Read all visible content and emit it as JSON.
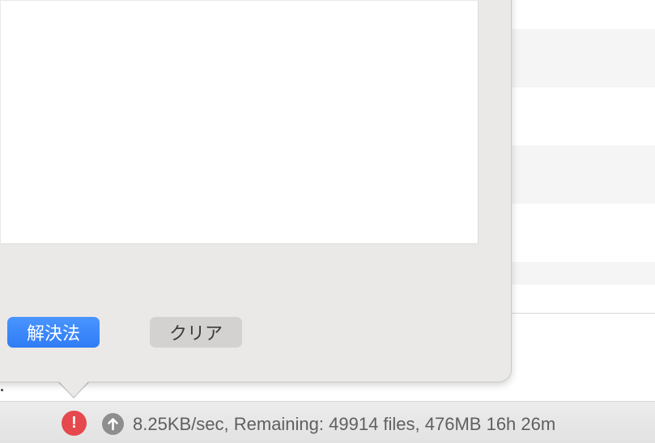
{
  "popover": {
    "buttons": {
      "solution_label": "解決法",
      "clear_label": "クリア"
    }
  },
  "status_bar": {
    "error_icon": "exclamation-icon",
    "error_glyph": "!",
    "upload_icon": "upload-arrow-icon",
    "transfer_text": "8.25KB/sec, Remaining: 49914 files, 476MB 16h 26m"
  },
  "colors": {
    "accent": "#2f7cf6",
    "error": "#e5484d",
    "popover_bg": "#ebe9e7"
  }
}
